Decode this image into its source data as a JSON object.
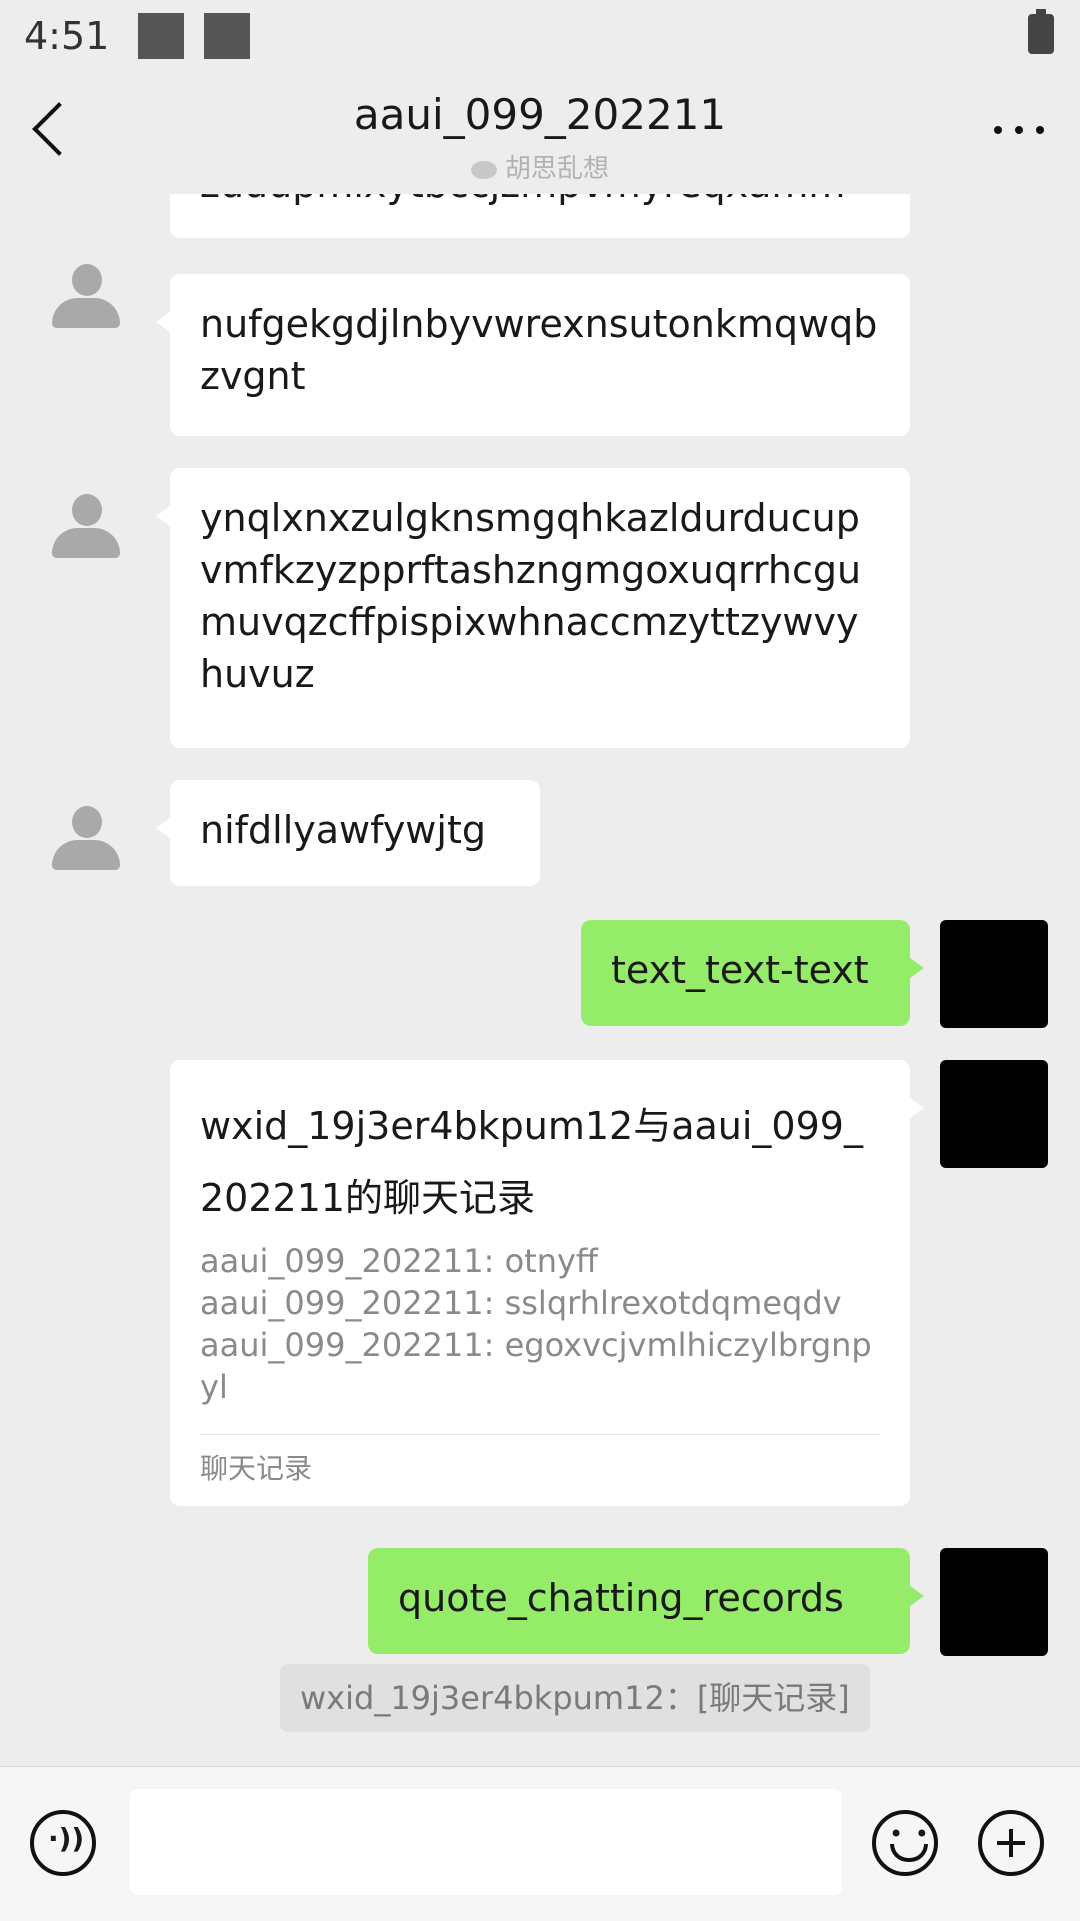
{
  "status_bar": {
    "time": "4:51"
  },
  "header": {
    "title": "aaui_099_202211",
    "subtitle": "胡思乱想"
  },
  "messages": {
    "m0_partial": "zuuupmixytbccjzmpvmyreqxamm",
    "m1": "nufgekgdjlnbyvwrexnsutonkmqwqbzvgnt",
    "m2": "ynqlxnxzulgknsmgqhkazldurducupvmfkzyzpprftashzngmgoxuqrrhcgumuvqzcffpispixwhnaccmzyttzywvyhuvuz",
    "m3": "nifdllyawfywjtg",
    "m4": "text_text-text",
    "record": {
      "title": "wxid_19j3er4bkpum12与aaui_099_202211的聊天记录",
      "lines": [
        "aaui_099_202211: otnyff",
        "aaui_099_202211: sslqrhlrexotdqmeqdv",
        "aaui_099_202211: egoxvcjvmlhiczylbrgnpyl"
      ],
      "footer": "聊天记录"
    },
    "m6": "quote_chatting_records",
    "quote": "wxid_19j3er4bkpum12：[聊天记录]"
  },
  "icons": {
    "back": "chevron-left-icon",
    "more": "more-dots-icon",
    "voice": "voice-icon",
    "emoji": "emoji-icon",
    "plus": "plus-icon",
    "avatar": "default-avatar-icon"
  },
  "colors": {
    "background": "#ededed",
    "sent_bubble": "#95ec69",
    "received_bubble": "#ffffff"
  }
}
